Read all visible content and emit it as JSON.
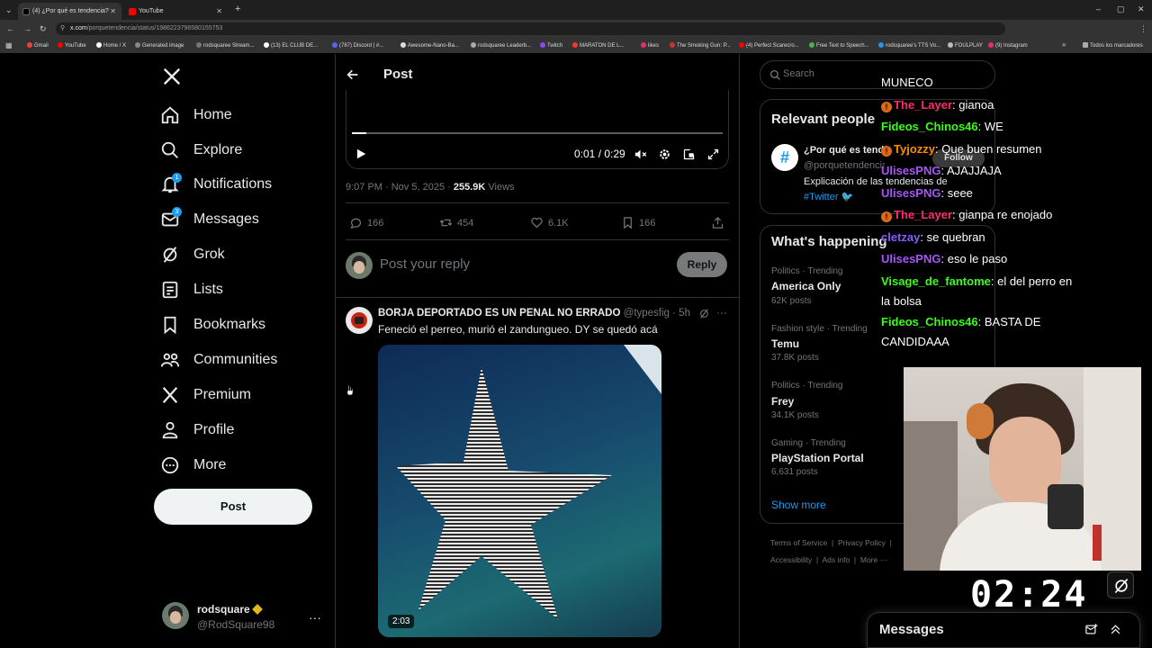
{
  "browser": {
    "tabs": [
      {
        "title": "(4) ¿Por qué es tendencia?",
        "active": true
      },
      {
        "title": "YouTube",
        "active": false
      }
    ],
    "url_domain": "x.com",
    "url_path": "/porquetendencia/status/1986223796580155753",
    "bookmarks": [
      "Gmail",
      "YouTube",
      "Home / X",
      "Generated image",
      "rodsquaree Stream...",
      "(13) EL CLUB DE...",
      "(787) Discord | #...",
      "Awesome-Nano-Ba...",
      "rodsquaree Leaderb...",
      "Twitch",
      "MARATON DE L...",
      "likes",
      "The Smoking Gun: P...",
      "(4) Perfect Scarecro...",
      "Free Text to Speech...",
      "rodsquaree's TTS Vo...",
      "FOULPLAY",
      "(9) Instagram"
    ],
    "all_bookmarks": "Todos los marcadores"
  },
  "nav": {
    "items": [
      {
        "label": "Home",
        "icon": "home-icon"
      },
      {
        "label": "Explore",
        "icon": "search-icon"
      },
      {
        "label": "Notifications",
        "icon": "bell-icon",
        "badge": "1"
      },
      {
        "label": "Messages",
        "icon": "mail-icon",
        "badge": "3"
      },
      {
        "label": "Grok",
        "icon": "grok-icon"
      },
      {
        "label": "Lists",
        "icon": "list-icon"
      },
      {
        "label": "Bookmarks",
        "icon": "bookmark-icon"
      },
      {
        "label": "Communities",
        "icon": "people-icon"
      },
      {
        "label": "Premium",
        "icon": "x-logo-icon"
      },
      {
        "label": "Profile",
        "icon": "person-icon"
      },
      {
        "label": "More",
        "icon": "more-circle-icon"
      }
    ],
    "post_button": "Post",
    "account": {
      "name": "rodsquare",
      "handle": "@RodSquare98"
    }
  },
  "post": {
    "header_title": "Post",
    "video_time": "0:01 / 0:29",
    "video_progress": 0.04,
    "timestamp": "9:07 PM · Nov 5, 2025 · ",
    "views_count": "255.9K",
    "views_label": " Views",
    "stats": {
      "replies": "166",
      "reposts": "454",
      "likes": "6.1K",
      "bookmarks": "166"
    },
    "reply_placeholder": "Post your reply",
    "reply_button": "Reply"
  },
  "reply": {
    "name": "BORJA DEPORTADO ES UN PENAL NO ERRADO",
    "handle": "@typesfig",
    "time": "· 5h",
    "text": "Feneció el perreo, murió el zandungueo. DY se quedó acá",
    "video_duration": "2:03"
  },
  "sidebar": {
    "search_placeholder": "Search",
    "relevant_title": "Relevant people",
    "relevant_name": "¿Por qué es tendencia?",
    "relevant_handle": "@porquetendencia",
    "relevant_bio": "Explicación de las tendencias de",
    "relevant_hashtag": "#Twitter",
    "follow_button": "Follow",
    "happening_title": "What's happening",
    "trends": [
      {
        "category": "Politics · Trending",
        "name": "America Only",
        "count": "62K posts"
      },
      {
        "category": "Fashion style · Trending",
        "name": "Temu",
        "count": "37.8K posts"
      },
      {
        "category": "Politics · Trending",
        "name": "Frey",
        "count": "34.1K posts"
      },
      {
        "category": "Gaming · Trending",
        "name": "PlayStation Portal",
        "count": "6,631 posts"
      }
    ],
    "show_more": "Show more",
    "footer_links": [
      "Terms of Service",
      "Privacy Policy",
      "Accessibility",
      "Ads info",
      "More ···"
    ]
  },
  "chat": {
    "lines": [
      {
        "user": "",
        "msg": "MUNECO",
        "color": "#ffffff"
      },
      {
        "user": "The_Layer",
        "msg": ": gianoa",
        "color": "#ff2d6a",
        "badge": true
      },
      {
        "user": "Fideos_Chinos46",
        "msg": ": WE",
        "color": "#39ff14"
      },
      {
        "user": "Tyjozzy",
        "msg": ": Que buen resumen",
        "color": "#ff8c00",
        "badge": true
      },
      {
        "user": "UlisesPNG",
        "msg": ": AJAJJAJA",
        "color": "#a855f7"
      },
      {
        "user": "UlisesPNG",
        "msg": ": seee",
        "color": "#a855f7"
      },
      {
        "user": "The_Layer",
        "msg": ": gianpa re enojado",
        "color": "#ff2d6a",
        "badge": true
      },
      {
        "user": "cletzay",
        "msg": ": se quebran",
        "color": "#8a5cff"
      },
      {
        "user": "UlisesPNG",
        "msg": ": eso le paso",
        "color": "#a855f7"
      },
      {
        "user": "Visage_de_fantome",
        "msg": ": el del perro en la bolsa",
        "color": "#39ff14"
      },
      {
        "user": "Fideos_Chinos46",
        "msg": ": BASTA DE CANDIDAAA",
        "color": "#39ff14"
      }
    ]
  },
  "overlay": {
    "timer": "02:24"
  },
  "messages_drawer": {
    "title": "Messages"
  }
}
